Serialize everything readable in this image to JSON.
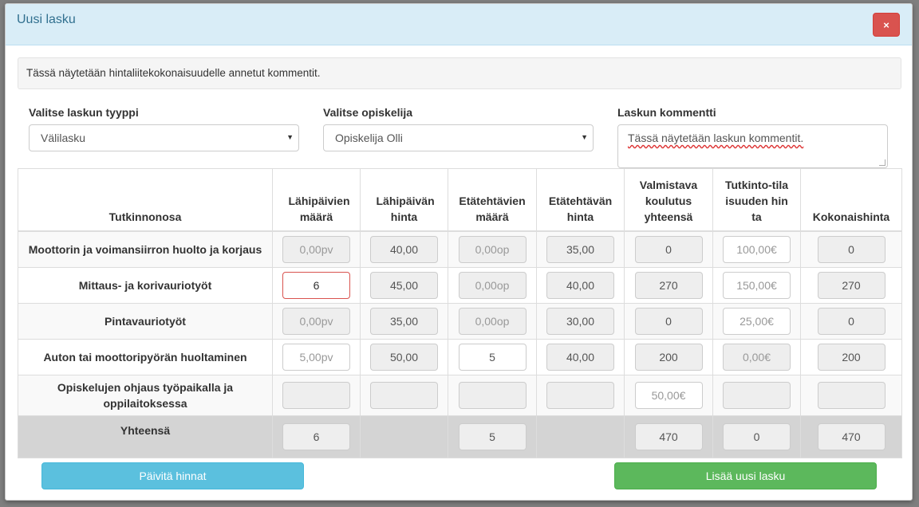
{
  "modal": {
    "title": "Uusi lasku",
    "close_icon": "×"
  },
  "info_text": "Tässä näytetään hintaliitekokonaisuudelle annetut kommentit.",
  "form": {
    "invoice_type_label": "Valitse laskun tyyppi",
    "invoice_type_value": "Välilasku",
    "student_label": "Valitse opiskelija",
    "student_value": "Opiskelija Olli",
    "comment_label": "Laskun kommentti",
    "comment_value": "Tässä näytetään laskun kommentit."
  },
  "table": {
    "headers": [
      "Tutkinnonosa",
      "Lähipäivien määrä",
      "Lähipäivän hinta",
      "Etätehtävien määrä",
      "Etätehtävän hinta",
      "Valmistava koulutus yhteensä",
      "Tutkinto-tilaisuuden hinta",
      "Kokonaishinta"
    ],
    "rows": [
      {
        "label": "Moottorin ja voimansiirron huolto ja korjaus",
        "cells": [
          {
            "text": "0,00pv",
            "kind": "readonly-placeholder"
          },
          {
            "text": "40,00",
            "kind": "readonly"
          },
          {
            "text": "0,00op",
            "kind": "readonly-placeholder"
          },
          {
            "text": "35,00",
            "kind": "readonly"
          },
          {
            "text": "0",
            "kind": "readonly"
          },
          {
            "text": "100,00€",
            "kind": "editable-placeholder"
          },
          {
            "text": "0",
            "kind": "readonly"
          }
        ]
      },
      {
        "label": "Mittaus- ja korivauriotyöt",
        "cells": [
          {
            "text": "6",
            "kind": "error"
          },
          {
            "text": "45,00",
            "kind": "readonly"
          },
          {
            "text": "0,00op",
            "kind": "readonly-placeholder"
          },
          {
            "text": "40,00",
            "kind": "readonly"
          },
          {
            "text": "270",
            "kind": "readonly"
          },
          {
            "text": "150,00€",
            "kind": "editable-placeholder"
          },
          {
            "text": "270",
            "kind": "readonly"
          }
        ]
      },
      {
        "label": "Pintavauriotyöt",
        "cells": [
          {
            "text": "0,00pv",
            "kind": "readonly-placeholder"
          },
          {
            "text": "35,00",
            "kind": "readonly"
          },
          {
            "text": "0,00op",
            "kind": "readonly-placeholder"
          },
          {
            "text": "30,00",
            "kind": "readonly"
          },
          {
            "text": "0",
            "kind": "readonly"
          },
          {
            "text": "25,00€",
            "kind": "editable-placeholder"
          },
          {
            "text": "0",
            "kind": "readonly"
          }
        ]
      },
      {
        "label": "Auton tai moottoripyörän huoltaminen",
        "cells": [
          {
            "text": "5,00pv",
            "kind": "editable-placeholder"
          },
          {
            "text": "50,00",
            "kind": "readonly"
          },
          {
            "text": "5",
            "kind": "editable"
          },
          {
            "text": "40,00",
            "kind": "readonly"
          },
          {
            "text": "200",
            "kind": "readonly"
          },
          {
            "text": "0,00€",
            "kind": "readonly-placeholder"
          },
          {
            "text": "200",
            "kind": "readonly"
          }
        ]
      },
      {
        "label": "Opiskelujen ohjaus työpaikalla ja oppilaitoksessa",
        "cells": [
          {
            "text": "",
            "kind": "readonly"
          },
          {
            "text": "",
            "kind": "readonly"
          },
          {
            "text": "",
            "kind": "readonly"
          },
          {
            "text": "",
            "kind": "readonly"
          },
          {
            "text": "50,00€",
            "kind": "editable-placeholder"
          },
          {
            "text": "",
            "kind": "readonly"
          },
          {
            "text": "",
            "kind": "readonly"
          }
        ]
      }
    ],
    "total": {
      "label": "Yhteensä",
      "cells": [
        "6",
        null,
        "5",
        null,
        "470",
        "0",
        "470"
      ]
    }
  },
  "buttons": {
    "update": "Päivitä hinnat",
    "add": "Lisää uusi lasku"
  }
}
